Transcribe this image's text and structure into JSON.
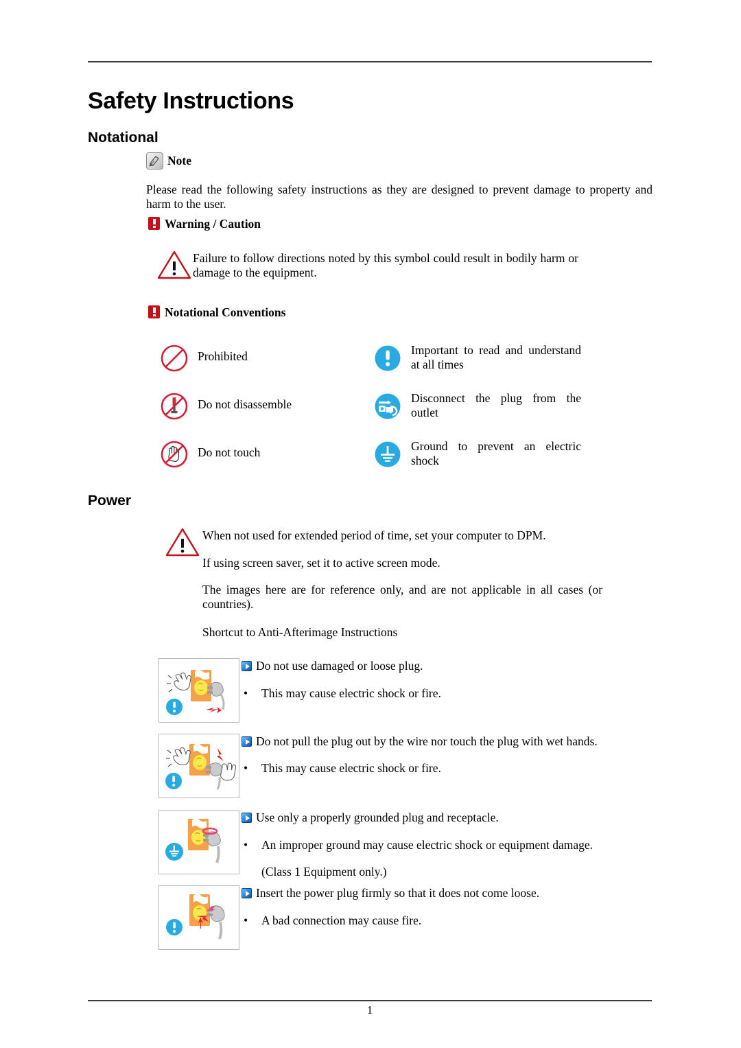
{
  "document": {
    "title": "Safety Instructions",
    "page_number": "1"
  },
  "sections": {
    "notational": {
      "heading": "Notational",
      "note": {
        "icon": "note-pencil-icon",
        "label": "Note",
        "body": "Please read the following safety instructions as they are designed to prevent damage to property and harm to the user."
      },
      "warning_caution": {
        "icon": "red-exclamation-badge-icon",
        "label": "Warning / Caution",
        "triangle_icon": "warning-triangle-icon",
        "body": "Failure to follow directions noted by this symbol could result in bodily harm or damage to the equipment."
      },
      "conventions": {
        "icon": "red-exclamation-badge-icon",
        "label": "Notational Conventions",
        "items": [
          {
            "icon": "prohibited-icon",
            "text": "Prohibited"
          },
          {
            "icon": "important-read-icon",
            "text": "Important to read and understand at all times"
          },
          {
            "icon": "do-not-disassemble-icon",
            "text": "Do not disassemble"
          },
          {
            "icon": "disconnect-plug-icon",
            "text": "Disconnect the plug from the outlet"
          },
          {
            "icon": "do-not-touch-icon",
            "text": "Do not touch"
          },
          {
            "icon": "ground-icon",
            "text": "Ground to prevent an electric shock"
          }
        ]
      }
    },
    "power": {
      "heading": "Power",
      "triangle_icon": "warning-triangle-icon",
      "paragraphs": [
        "When not used for extended period of time, set your computer to DPM.",
        "If using screen saver, set it to active screen mode.",
        "The images here are for reference only, and are not applicable in all cases (or countries).",
        "Shortcut to Anti-Afterimage Instructions"
      ],
      "instructions": [
        {
          "illustration": "damaged-loose-plug-illustration",
          "badge": "blue-exclamation-badge",
          "title": "Do not use damaged or loose plug.",
          "details": [
            "This may cause electric shock or fire."
          ]
        },
        {
          "illustration": "pull-plug-wet-hands-illustration",
          "badge": "blue-exclamation-badge",
          "title": "Do not pull the plug out by the wire nor touch the plug with wet hands.",
          "details": [
            "This may cause electric shock or fire."
          ]
        },
        {
          "illustration": "grounded-plug-receptacle-illustration",
          "badge": "blue-ground-badge",
          "title": "Use only a properly grounded plug and receptacle.",
          "details": [
            "An improper ground may cause electric shock or equipment damage."
          ],
          "note": "(Class 1 Equipment only.)"
        },
        {
          "illustration": "insert-plug-firmly-illustration",
          "badge": "blue-exclamation-badge",
          "title": "Insert the power plug firmly so that it does not come loose.",
          "details": [
            "A bad connection may cause fire."
          ]
        }
      ]
    }
  },
  "colors": {
    "accent_red": "#c31118",
    "accent_blue": "#29abe2",
    "rule_gray": "#3b3b3b",
    "illustration_orange": "#f4a14a",
    "illustration_yellow": "#ffe84d"
  }
}
